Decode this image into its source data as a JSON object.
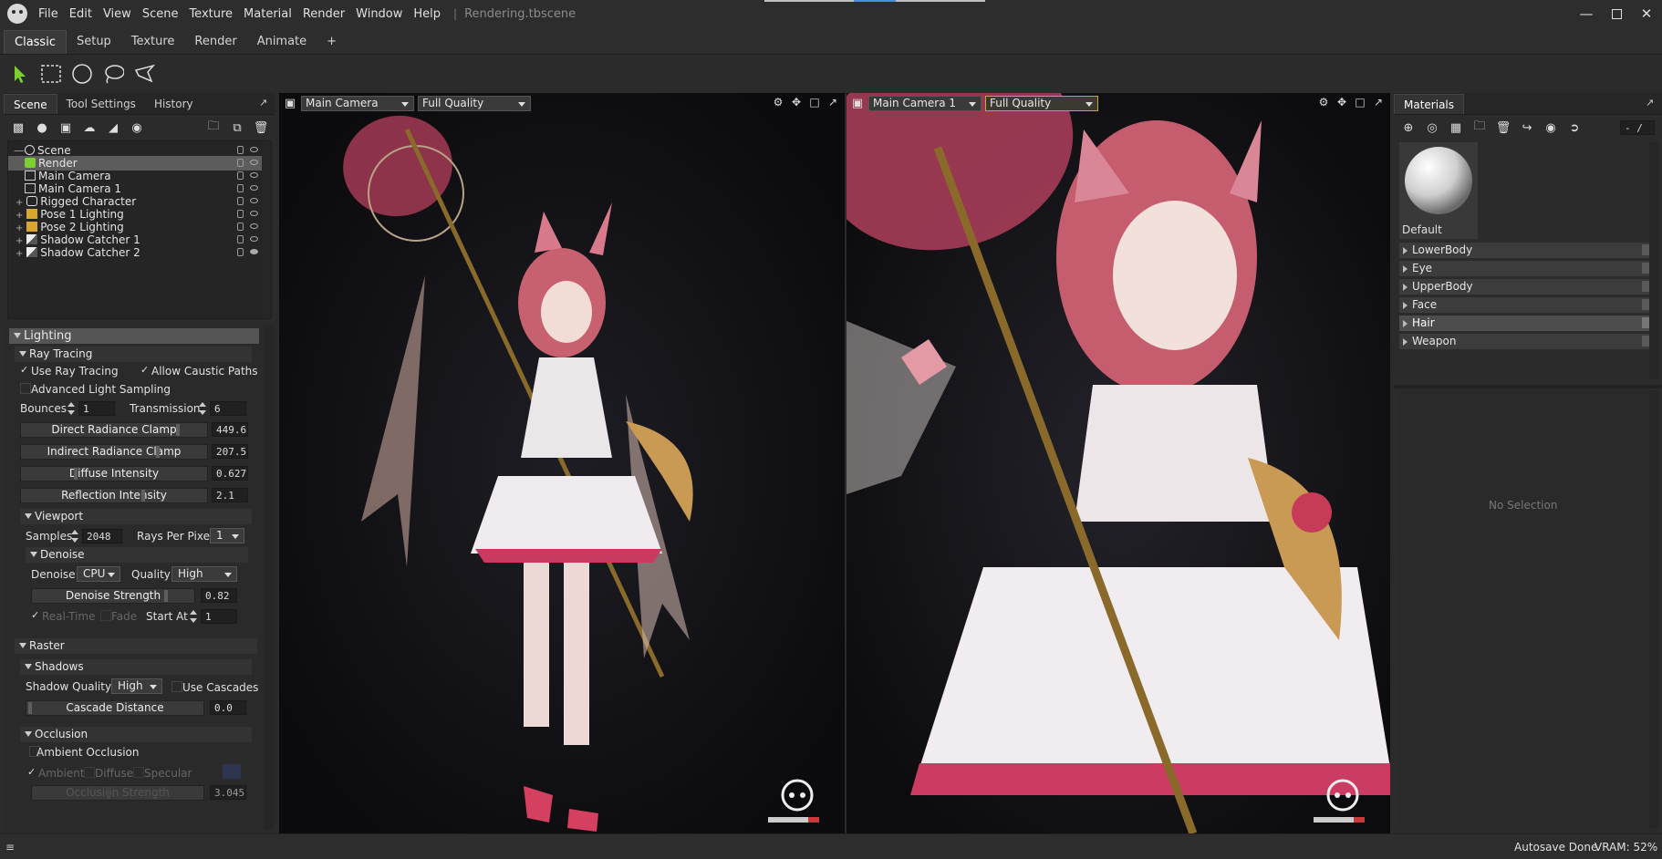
{
  "menu": [
    "File",
    "Edit",
    "View",
    "Scene",
    "Texture",
    "Material",
    "Render",
    "Window",
    "Help"
  ],
  "document_title": "Rendering.tbscene",
  "workspace_tabs": [
    "Classic",
    "Setup",
    "Texture",
    "Render",
    "Animate",
    "+"
  ],
  "left_panel": {
    "tabs": [
      "Scene",
      "Tool Settings",
      "History"
    ],
    "tree": [
      {
        "label": "Scene",
        "level": 0
      },
      {
        "label": "Render",
        "level": 1,
        "selected": true
      },
      {
        "label": "Main Camera",
        "level": 1
      },
      {
        "label": "Main Camera 1",
        "level": 1
      },
      {
        "label": "Rigged Character",
        "level": 1
      },
      {
        "label": "Pose 1 Lighting",
        "level": 1
      },
      {
        "label": "Pose 2 Lighting",
        "level": 1
      },
      {
        "label": "Shadow Catcher 1",
        "level": 1
      },
      {
        "label": "Shadow Catcher 2",
        "level": 1
      }
    ]
  },
  "props": {
    "lighting": "Lighting",
    "ray_tracing": "Ray Tracing",
    "use_ray_tracing": "Use Ray Tracing",
    "allow_caustic": "Allow Caustic Paths",
    "adv_light": "Advanced Light Sampling",
    "bounces_label": "Bounces",
    "bounces": "1",
    "transmission_label": "Transmission",
    "transmission": "6",
    "direct_clamp_label": "Direct Radiance Clamp",
    "direct_clamp": "449.6",
    "indirect_clamp_label": "Indirect Radiance Clamp",
    "indirect_clamp": "207.5",
    "diffuse_label": "Diffuse Intensity",
    "diffuse": "0.627",
    "reflection_label": "Reflection Intensity",
    "reflection": "2.1",
    "viewport": "Viewport",
    "samples_label": "Samples",
    "samples": "2048",
    "rays_label": "Rays Per Pixel",
    "rays": "1",
    "denoise": "Denoise",
    "denoise_label": "Denoise",
    "denoise_device": "CPU",
    "quality_label": "Quality",
    "quality": "High",
    "denoise_strength_label": "Denoise Strength",
    "denoise_strength": "0.82",
    "realtime": "Real-Time",
    "fade": "Fade",
    "start_at_label": "Start At",
    "start_at": "1",
    "raster": "Raster",
    "shadows": "Shadows",
    "shadow_quality_label": "Shadow Quality",
    "shadow_quality": "High",
    "use_cascades": "Use Cascades",
    "cascade_label": "Cascade Distance",
    "cascade": "0.0",
    "occlusion": "Occlusion",
    "ambient_occlusion": "Ambient Occlusion",
    "ambient": "Ambient",
    "diffuse_opt": "Diffuse",
    "specular_opt": "Specular",
    "occlusion_strength_label": "Occlusion Strength",
    "occlusion_strength": "3.045"
  },
  "viewport1": {
    "camera": "Main Camera",
    "quality": "Full Quality"
  },
  "viewport2": {
    "camera": "Main Camera 1",
    "quality": "Full Quality"
  },
  "materials": {
    "tab": "Materials",
    "pager": "- /",
    "default_label": "Default",
    "items": [
      "LowerBody",
      "Eye",
      "UpperBody",
      "Face",
      "Hair",
      "Weapon"
    ],
    "selected": "Hair",
    "no_selection": "No Selection"
  },
  "status": {
    "autosave": "Autosave Done",
    "vram": "VRAM: 52%"
  },
  "colors": {
    "accent_green": "#7bd12f",
    "selection": "#5c5c5c",
    "hair_pink": "#d9738a",
    "dress_white": "#e8e4e6"
  }
}
